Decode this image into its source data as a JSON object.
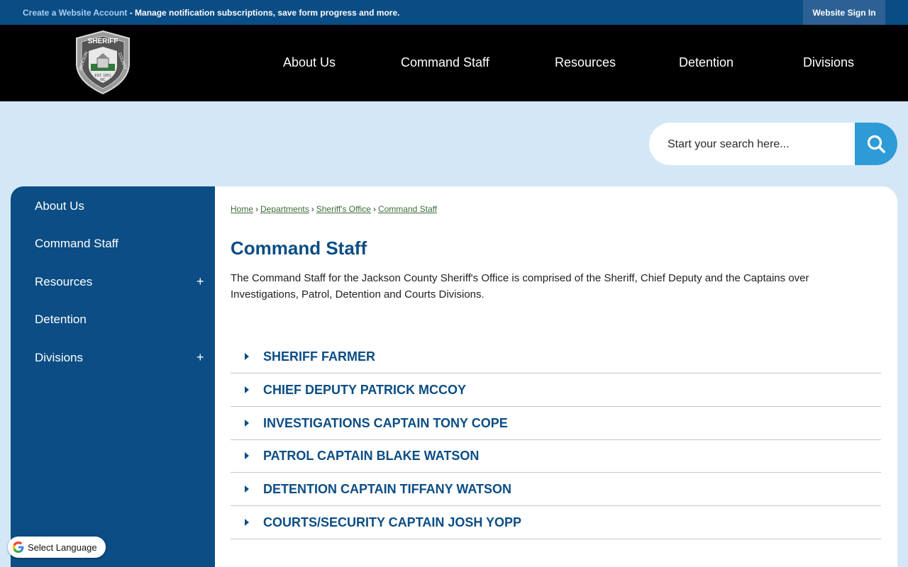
{
  "topbar": {
    "create_link": "Create a Website Account",
    "notice_text": " - Manage notification subscriptions, save form progress and more.",
    "signin_label": "Website Sign In"
  },
  "header": {
    "logo_text_top": "SHERIFF",
    "logo_text_left": "JACKSON",
    "logo_text_right": "COUNTY",
    "logo_est": "EST. 1851",
    "logo_state": "NC",
    "nav": [
      "About Us",
      "Command Staff",
      "Resources",
      "Detention",
      "Divisions"
    ]
  },
  "search": {
    "placeholder": "Start your search here..."
  },
  "sidebar": {
    "items": [
      {
        "label": "About Us"
      },
      {
        "label": "Command Staff"
      },
      {
        "label": "Resources",
        "expand": "+"
      },
      {
        "label": "Detention"
      },
      {
        "label": "Divisions",
        "expand": "+"
      }
    ]
  },
  "breadcrumb": {
    "items": [
      "Home",
      "Departments",
      "Sheriff's Office",
      "Command Staff"
    ],
    "separator": "›"
  },
  "main": {
    "title": "Command Staff",
    "intro": "The Command Staff for the Jackson County Sheriff's Office is comprised of the Sheriff, Chief Deputy and the Captains over Investigations, Patrol, Detention and Courts Divisions.",
    "accordion": [
      "SHERIFF FARMER",
      "CHIEF DEPUTY PATRICK MCCOY",
      "INVESTIGATIONS CAPTAIN TONY COPE",
      "PATROL CAPTAIN BLAKE WATSON",
      "DETENTION CAPTAIN TIFFANY WATSON",
      "COURTS/SECURITY CAPTAIN JOSH YOPP"
    ]
  },
  "language": {
    "label": "Select Language"
  },
  "colors": {
    "brand_blue": "#0b4d84",
    "topbar_blue": "#0a4d85",
    "search_button": "#2e9bd6",
    "page_background": "#d3e7f7"
  }
}
